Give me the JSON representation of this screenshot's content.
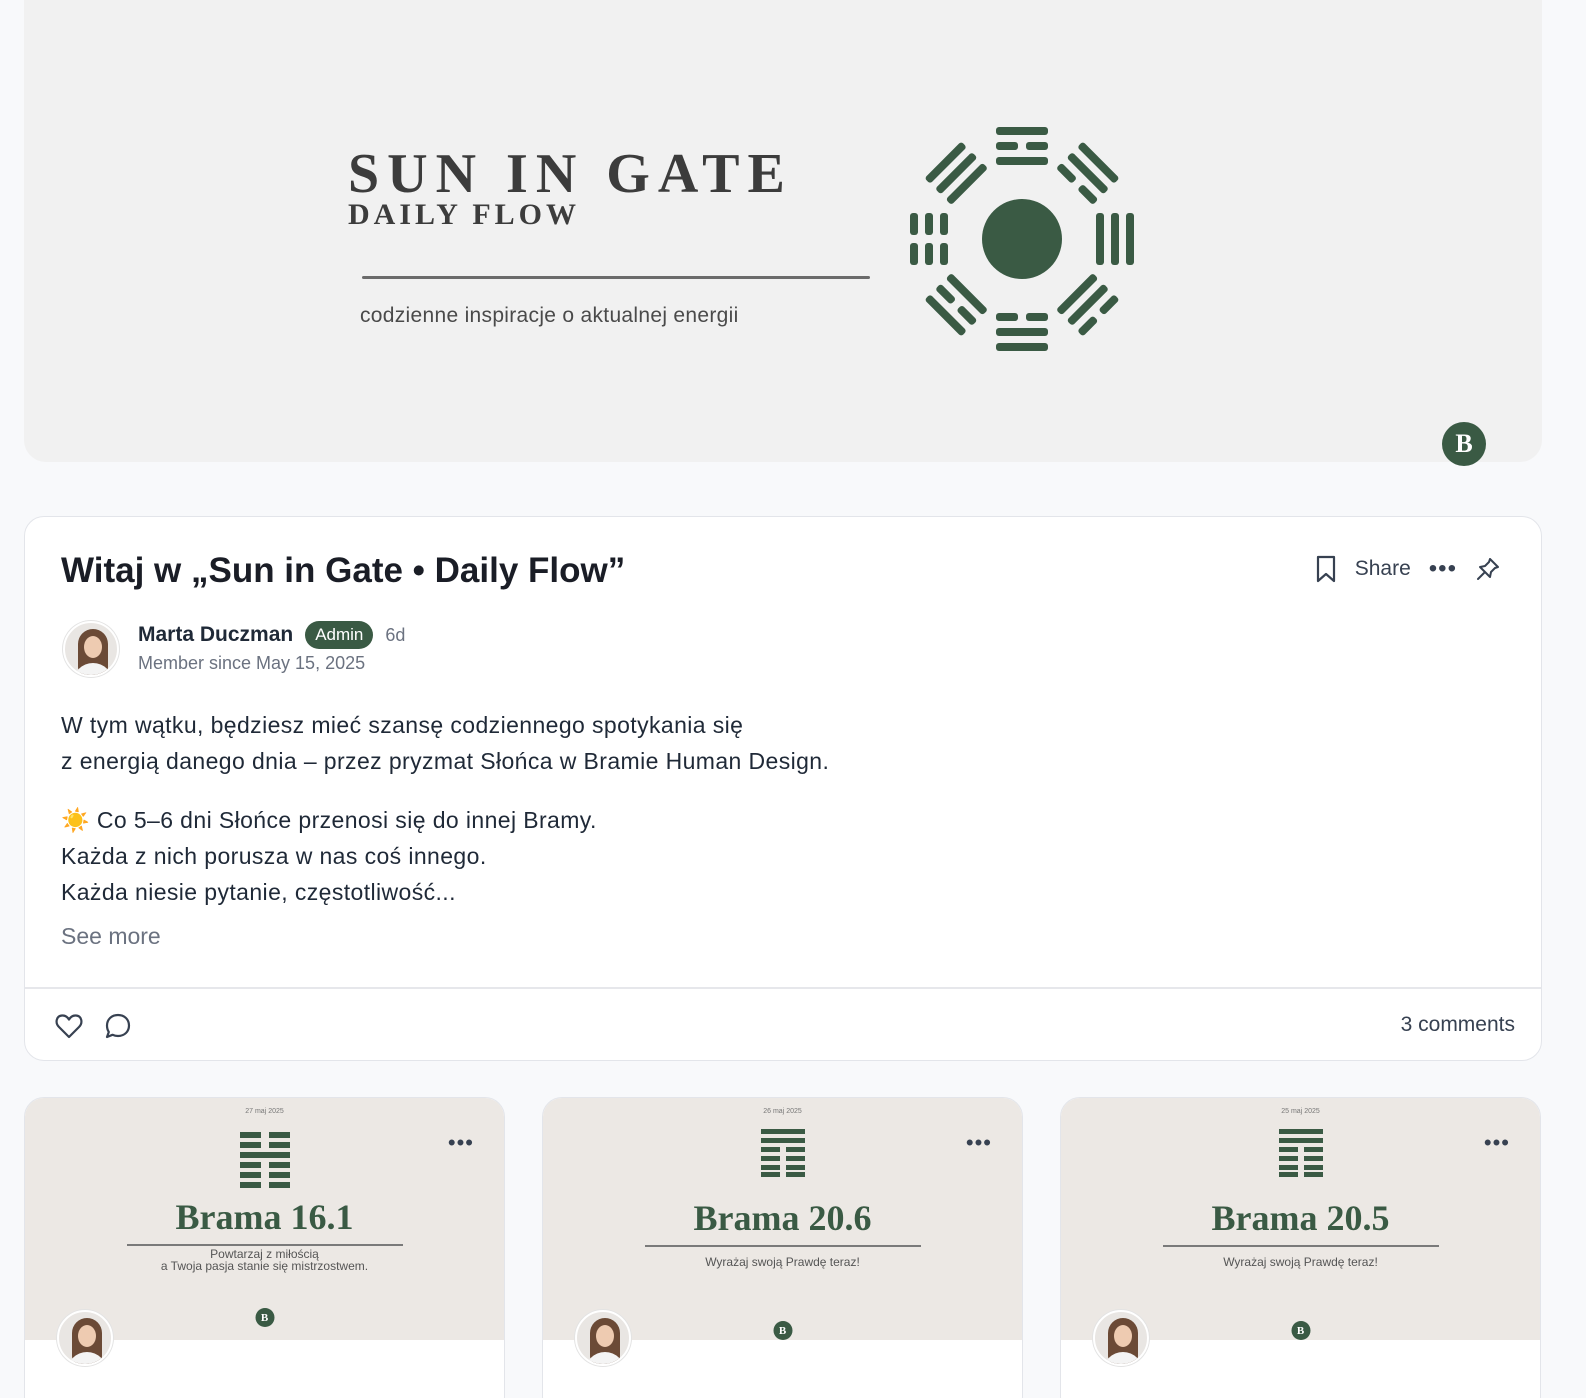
{
  "banner": {
    "title": "SUN IN GATE",
    "subtitle": "DAILY FLOW",
    "tagline": "codzienne inspiracje o aktualnej energii",
    "corner_logo": "B",
    "accent": "#3a5a44"
  },
  "post": {
    "title": "Witaj w „Sun in Gate • Daily Flow”",
    "actions": {
      "share_label": "Share",
      "more_label": "•••"
    },
    "author": {
      "name": "Marta Duczman",
      "role_badge": "Admin",
      "age": "6d",
      "member_since": "Member since May 15, 2025"
    },
    "body": {
      "p1_line1": "W tym wątku, będziesz mieć szansę codziennego spotykania się",
      "p1_line2": "z energią danego dnia – przez pryzmat Słońca w Bramie Human Design.",
      "p2_line1": "☀️ Co 5–6 dni Słońce przenosi się do innej Bramy.",
      "p2_line2": "Każda z nich porusza w nas coś innego.",
      "p2_line3": "Każda niesie pytanie, częstotliwość..."
    },
    "see_more": "See more",
    "comments_count": "3 comments"
  },
  "cards": [
    {
      "date": "27 maj 2025",
      "title": "Brama 16.1",
      "subtitle": "Powtarzaj z miłością\na Twoja pasja stanie się mistrzostwem.",
      "logo": "B",
      "more_label": "•••"
    },
    {
      "date": "26 maj 2025",
      "title": "Brama 20.6",
      "subtitle": "Wyrażaj swoją Prawdę teraz!",
      "logo": "B",
      "more_label": "•••"
    },
    {
      "date": "25 maj 2025",
      "title": "Brama 20.5",
      "subtitle": "Wyrażaj swoją Prawdę teraz!",
      "logo": "B",
      "more_label": "•••"
    }
  ]
}
